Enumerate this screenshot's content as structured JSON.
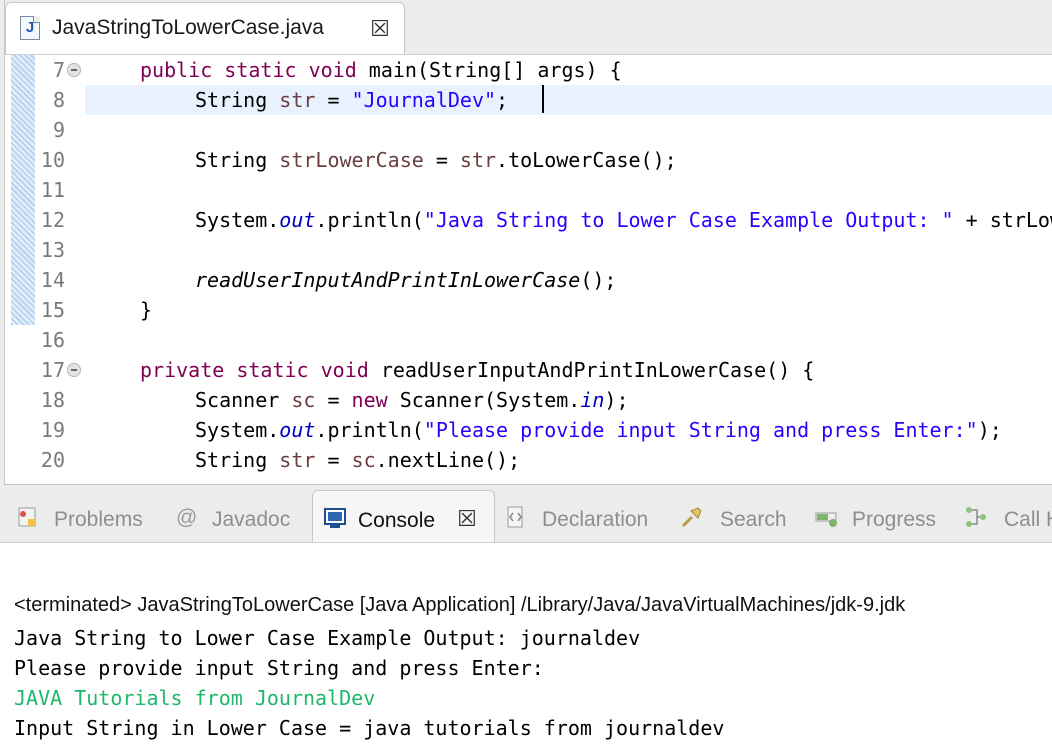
{
  "editor": {
    "tab_label": "JavaStringToLowerCase.java",
    "file_icon_letter": "J",
    "close_glyph": "☒",
    "current_line": 8
  },
  "code_lines": [
    {
      "num": "7",
      "fold": true
    },
    {
      "num": "8"
    },
    {
      "num": "9"
    },
    {
      "num": "10"
    },
    {
      "num": "11"
    },
    {
      "num": "12"
    },
    {
      "num": "13"
    },
    {
      "num": "14"
    },
    {
      "num": "15"
    },
    {
      "num": "16"
    },
    {
      "num": "17",
      "fold": true
    },
    {
      "num": "18"
    },
    {
      "num": "19"
    },
    {
      "num": "20"
    }
  ],
  "code": {
    "l7": {
      "kw1": "public",
      "kw2": "static",
      "kw3": "void",
      "rest": " main(String[] args) {"
    },
    "l8": {
      "pre": "String ",
      "var": "str",
      "mid": " = ",
      "str": "\"JournalDev\"",
      "post": ";"
    },
    "l10": {
      "pre": "String ",
      "var": "strLowerCase",
      "mid": " = ",
      "var2": "str",
      "post": ".toLowerCase();"
    },
    "l12": {
      "pre": "System.",
      "fld": "out",
      "mid": ".println(",
      "str": "\"Java String to Lower Case Example Output: \"",
      "post": " + strLowerCase);"
    },
    "l14": {
      "ital": "readUserInputAndPrintInLowerCase",
      "post": "();"
    },
    "l15": {
      "text": "}"
    },
    "l17": {
      "kw1": "private",
      "kw2": "static",
      "kw3": "void",
      "rest": " readUserInputAndPrintInLowerCase() {"
    },
    "l18": {
      "pre": "Scanner ",
      "var": "sc",
      "mid": " = ",
      "kw": "new",
      "mid2": " Scanner(System.",
      "fld": "in",
      "post": ");"
    },
    "l19": {
      "pre": "System.",
      "fld": "out",
      "mid": ".println(",
      "str": "\"Please provide input String and press Enter:\"",
      "post": ");"
    },
    "l20": {
      "pre": "String ",
      "var": "str",
      "mid": " = ",
      "var2": "sc",
      "post": ".nextLine();"
    }
  },
  "panel": {
    "tabs": [
      {
        "label": "Problems",
        "icon": "problems-icon",
        "active": false
      },
      {
        "label": "Javadoc",
        "icon": "at-icon",
        "active": false
      },
      {
        "label": "Console",
        "icon": "console-icon",
        "active": true
      },
      {
        "label": "Declaration",
        "icon": "declaration-icon",
        "active": false
      },
      {
        "label": "Search",
        "icon": "search-icon",
        "active": false
      },
      {
        "label": "Progress",
        "icon": "progress-icon",
        "active": false
      },
      {
        "label": "Call Hierarchy",
        "icon": "call-hierarchy-icon",
        "active": false
      }
    ],
    "javadoc_glyph": "@"
  },
  "console": {
    "terminated": "<terminated> JavaStringToLowerCase [Java Application] /Library/Java/JavaVirtualMachines/jdk-9.jdk",
    "lines": [
      {
        "text": "Java String to Lower Case Example Output: journaldev",
        "color": "#000000"
      },
      {
        "text": "Please provide input String and press Enter:",
        "color": "#000000"
      },
      {
        "text": "JAVA Tutorials from JournalDev",
        "color": "#1fb86b"
      },
      {
        "text": "Input String in Lower Case = java tutorials from journaldev",
        "color": "#000000"
      }
    ]
  },
  "colors": {
    "keyword": "#7f0055",
    "string": "#2a00ff",
    "field": "#0000c0",
    "local_var": "#6a3e3e",
    "console_input": "#1fb86b"
  }
}
